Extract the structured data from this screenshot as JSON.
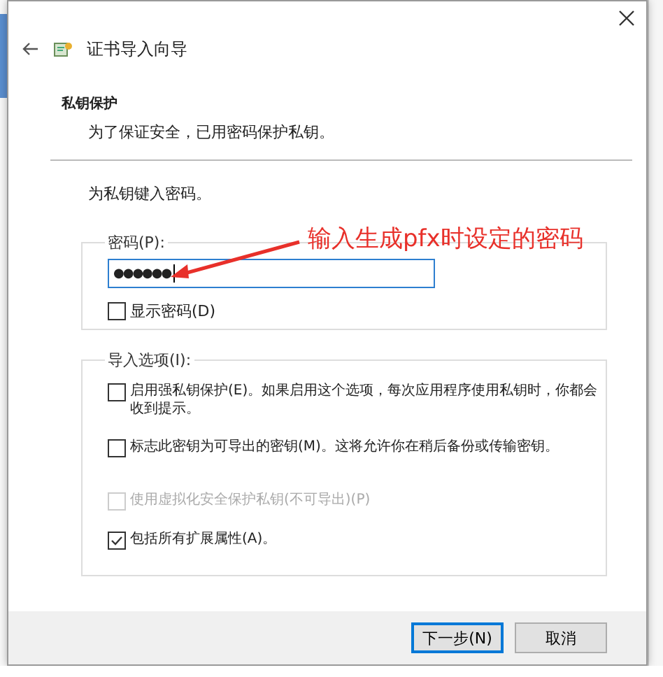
{
  "dialog": {
    "title": "证书导入向导"
  },
  "section": {
    "title": "私钥保护",
    "subtitle": "为了保证安全，已用密码保护私钥。"
  },
  "prompt": "为私钥键入密码。",
  "password_group": {
    "legend": "密码(P):",
    "value": "●●●●●●",
    "show_password": {
      "label": "显示密码(D)",
      "checked": false
    }
  },
  "import_options": {
    "legend": "导入选项(I):",
    "options": [
      {
        "label": "启用强私钥保护(E)。如果启用这个选项，每次应用程序使用私钥时，你都会收到提示。",
        "checked": false,
        "disabled": false
      },
      {
        "label": "标志此密钥为可导出的密钥(M)。这将允许你在稍后备份或传输密钥。",
        "checked": false,
        "disabled": false
      },
      {
        "label": "使用虚拟化安全保护私钥(不可导出)(P)",
        "checked": false,
        "disabled": true
      },
      {
        "label": "包括所有扩展属性(A)。",
        "checked": true,
        "disabled": false
      }
    ]
  },
  "buttons": [
    {
      "label": "下一步(N)",
      "default": true
    },
    {
      "label": "取消",
      "default": false
    }
  ],
  "annotation": {
    "text": "输入生成pfx时设定的密码"
  }
}
